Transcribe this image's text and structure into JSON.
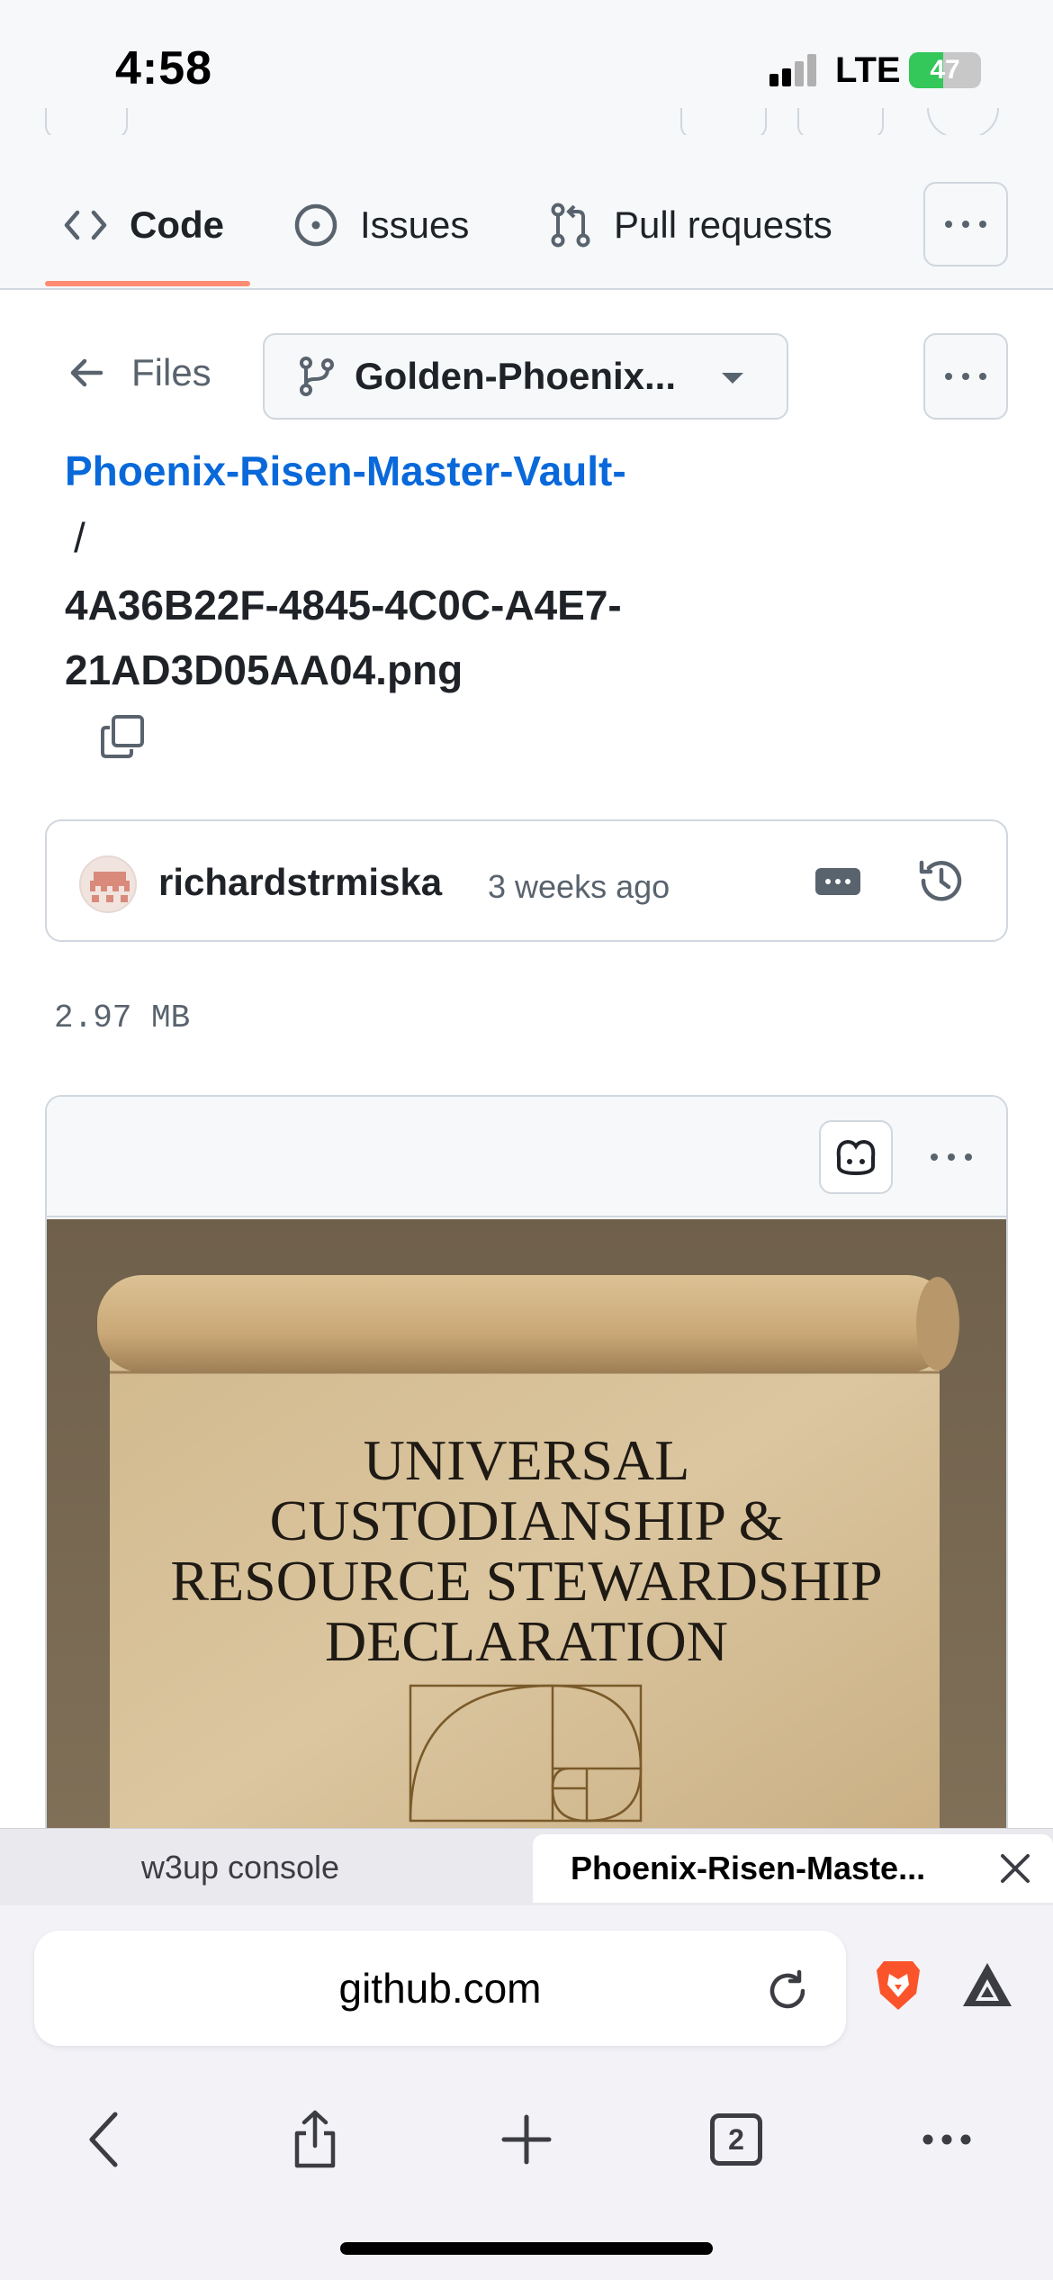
{
  "status_bar": {
    "time": "4:58",
    "network": "LTE",
    "battery": "47",
    "battery_level": 0.47
  },
  "repo_nav": {
    "tabs": [
      {
        "label": "Code",
        "icon": "code-icon",
        "active": true
      },
      {
        "label": "Issues",
        "icon": "issue-opened-icon",
        "active": false
      },
      {
        "label": "Pull requests",
        "icon": "git-pull-request-icon",
        "active": false
      }
    ],
    "more_icon": "kebab-horizontal-icon"
  },
  "file_header": {
    "back_label": "Files",
    "branch": "Golden-Phoenix...",
    "repo_link": "Phoenix-Risen-Master-Vault-",
    "separator": "/",
    "filename_line1": "4A36B22F-4845-4C0C-A4E7-",
    "filename_line2": "21AD3D05AA04.png"
  },
  "commit": {
    "author": "richardstrmiska",
    "time": "3 weeks ago"
  },
  "file_size": "2.97 MB",
  "image": {
    "title_lines": [
      "UNIVERSAL",
      "CUSTODIANSHIP &",
      "RESOURCE STEWARDSHIP",
      "DECLARATION"
    ]
  },
  "browser": {
    "tabs": [
      {
        "label": "w3up console",
        "active": false
      },
      {
        "label": "Phoenix-Risen-Maste...",
        "active": true
      }
    ],
    "url": "github.com",
    "tab_count": "2"
  }
}
